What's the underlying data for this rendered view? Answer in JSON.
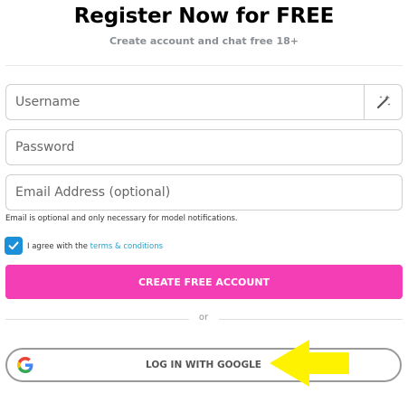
{
  "header": {
    "title": "Register Now for FREE",
    "subtitle": "Create account and chat free 18+"
  },
  "form": {
    "username_placeholder": "Username",
    "password_placeholder": "Password",
    "email_placeholder": "Email Address (optional)",
    "email_hint": "Email is optional and only necessary for model notifications.",
    "generate_icon": "magic-wand-icon"
  },
  "agree": {
    "checked": true,
    "prefix": "I agree with the ",
    "link": "terms & conditions"
  },
  "buttons": {
    "create": "CREATE FREE ACCOUNT",
    "or": "or",
    "google": "LOG IN WITH GOOGLE"
  },
  "colors": {
    "accent_pink": "#f43eb6",
    "checkbox_blue": "#1b8fd8",
    "link_blue": "#2a9fc9",
    "arrow_yellow": "#fff200"
  },
  "icons": [
    "magic-wand-icon",
    "checkmark-icon",
    "google-logo-icon",
    "arrow-pointer-icon"
  ]
}
